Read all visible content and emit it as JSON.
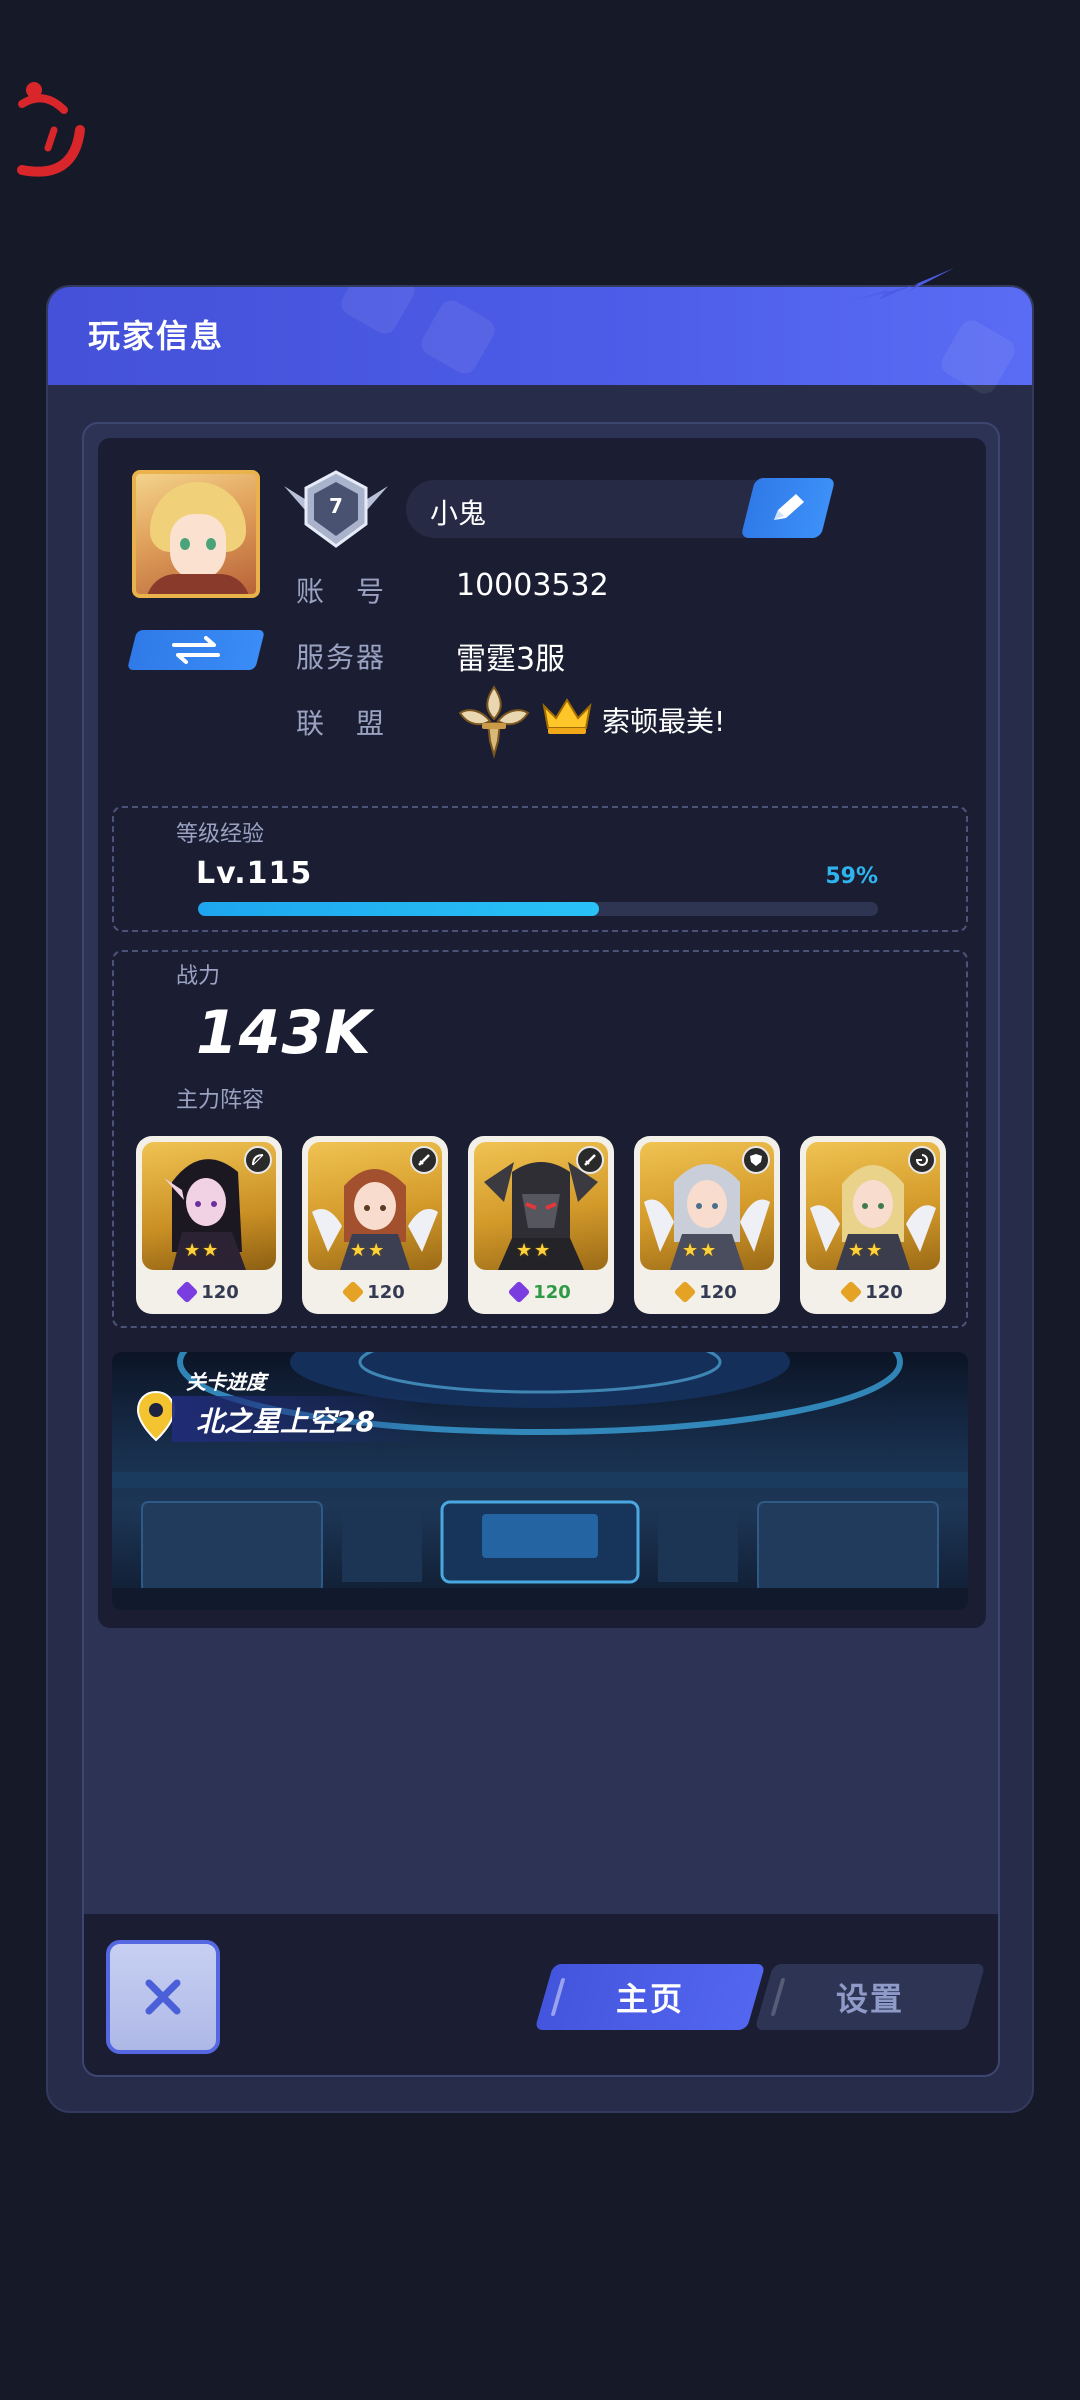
{
  "panel": {
    "title": "玩家信息"
  },
  "profile": {
    "rank_level": "7",
    "name": "小鬼",
    "account_label": "账　号",
    "account_value": "10003532",
    "server_label": "服务器",
    "server_value": "雷霆3服",
    "alliance_label": "联　盟",
    "alliance_value": "索顿最美!"
  },
  "experience": {
    "label": "等级经验",
    "level": "Lv.115",
    "percent_text": "59%",
    "progress": 0.59
  },
  "power": {
    "label": "战力",
    "value": "143K",
    "lineup_label": "主力阵容"
  },
  "heroes": [
    {
      "name_icon": "dark-elf-hero",
      "class_icon": "bow-icon",
      "stars": 2,
      "gem": "purple",
      "level": "120"
    },
    {
      "name_icon": "redhead-angel-hero",
      "class_icon": "sword-icon",
      "stars": 2,
      "gem": "gold",
      "level": "120"
    },
    {
      "name_icon": "dark-knight-hero",
      "class_icon": "sword-icon",
      "stars": 2,
      "gem": "purple",
      "level": "120"
    },
    {
      "name_icon": "silver-hair-hero",
      "class_icon": "shield-icon",
      "stars": 2,
      "gem": "gold",
      "level": "120"
    },
    {
      "name_icon": "blonde-angel-hero",
      "class_icon": "swirl-icon",
      "stars": 2,
      "gem": "gold",
      "level": "120"
    }
  ],
  "stage": {
    "label": "关卡进度",
    "name": "北之星上空28"
  },
  "tabs": {
    "home": "主页",
    "settings": "设置"
  },
  "colors": {
    "accent": "#4c5ce6",
    "exp_bar": "#1da6ef",
    "panel_bg": "#262c4a",
    "card_bg": "#1b1e32"
  }
}
